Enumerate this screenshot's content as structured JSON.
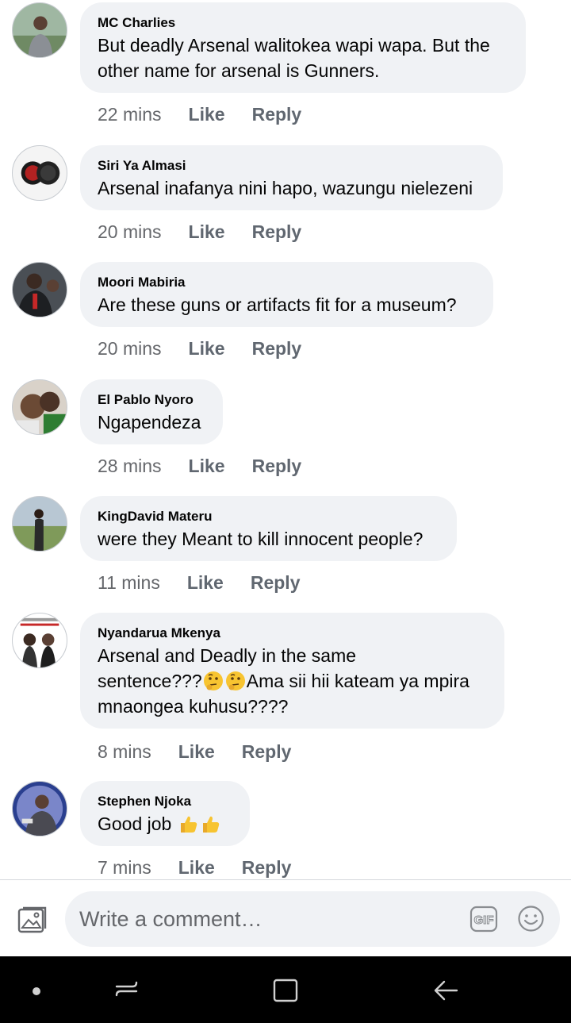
{
  "comments": [
    {
      "author": "MC Charlies",
      "lines": [
        "But deadly Arsenal walitokea wapi wapa. But the",
        "other name for arsenal is Gunners."
      ],
      "time": "22 mins",
      "like": "Like",
      "reply": "Reply"
    },
    {
      "author": "Siri Ya Almasi",
      "lines": [
        "Arsenal inafanya nini hapo, wazungu nielezeni"
      ],
      "time": "20 mins",
      "like": "Like",
      "reply": "Reply"
    },
    {
      "author": "Moori Mabiria",
      "lines": [
        "Are these guns or artifacts fit for a museum?"
      ],
      "time": "20 mins",
      "like": "Like",
      "reply": "Reply"
    },
    {
      "author": "El Pablo Nyoro",
      "lines": [
        "Ngapendeza"
      ],
      "time": "28 mins",
      "like": "Like",
      "reply": "Reply"
    },
    {
      "author": "KingDavid Materu",
      "lines": [
        "were they Meant to kill innocent people?"
      ],
      "time": "11 mins",
      "like": "Like",
      "reply": "Reply"
    },
    {
      "author": "Nyandarua Mkenya",
      "lines": [
        "Arsenal and Deadly in the same",
        "sentence???",
        "Ama sii hii kateam ya mpira",
        "mnaongea kuhusu????"
      ],
      "time": "8 mins",
      "like": "Like",
      "reply": "Reply"
    },
    {
      "author": "Stephen Njoka",
      "lines": [
        "Good job "
      ],
      "time": "7 mins",
      "like": "Like",
      "reply": "Reply"
    }
  ],
  "composer": {
    "placeholder": "Write a comment…",
    "gif_label": "GIF",
    "photo_icon": "photo-icon",
    "emoji_icon": "smiley-icon"
  },
  "navbar": {
    "icons": [
      "dot-icon",
      "recent-apps-icon",
      "home-icon",
      "back-icon"
    ]
  },
  "colors": {
    "bubble": "#f0f2f5",
    "meta_text": "#65676b",
    "action_text": "#606770",
    "navbar": "#000000"
  }
}
